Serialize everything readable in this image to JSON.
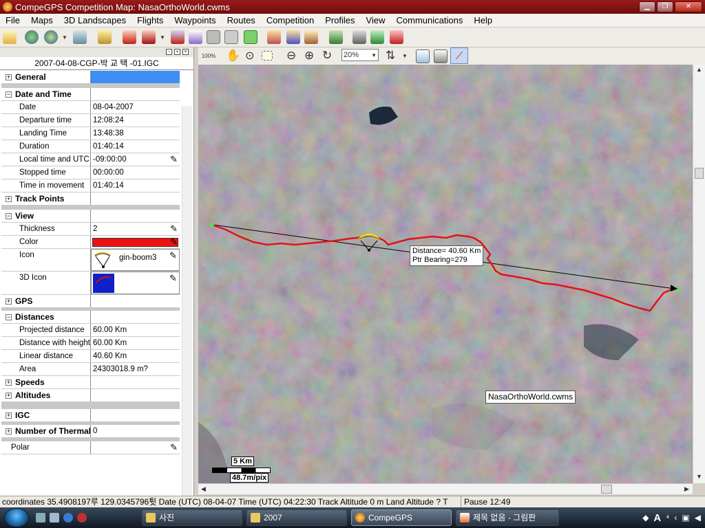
{
  "window": {
    "title": "CompeGPS Competition Map: NasaOrthoWorld.cwms"
  },
  "menu": [
    "File",
    "Maps",
    "3D Landscapes",
    "Flights",
    "Waypoints",
    "Routes",
    "Competition",
    "Profiles",
    "View",
    "Communications",
    "Help"
  ],
  "toolbar2": {
    "zoom_100": "100%",
    "zoom_value": "20%"
  },
  "leftpane": {
    "title": "2007-04-08-CGP-박 교 택 -01.IGC",
    "sections": {
      "general": "General",
      "datetime": "Date and Time",
      "trackpoints": "Track Points",
      "view": "View",
      "gps": "GPS",
      "distances": "Distances",
      "speeds": "Speeds",
      "altitudes": "Altitudes",
      "igc": "IGC",
      "thermals": "Number of Thermal",
      "thermals_val": "0",
      "polar": "Polar"
    },
    "datetime": [
      {
        "label": "Date",
        "value": "08-04-2007"
      },
      {
        "label": "Departure time",
        "value": "12:08:24"
      },
      {
        "label": "Landing Time",
        "value": "13:48:38"
      },
      {
        "label": "Duration",
        "value": "01:40:14"
      },
      {
        "label": "Local time and UTC d",
        "value": "-09:00:00"
      },
      {
        "label": "Stopped time",
        "value": "00:00:00"
      },
      {
        "label": "Time in movement",
        "value": "01:40:14"
      }
    ],
    "view": {
      "thickness_label": "Thickness",
      "thickness": "2",
      "color_label": "Color",
      "color": "#ee1111",
      "icon_label": "Icon",
      "icon_name": "gin-boom3",
      "icon3d_label": "3D Icon"
    },
    "distances": [
      {
        "label": "Projected distance",
        "value": "60.00 Km"
      },
      {
        "label": "Distance with height",
        "value": "60.00 Km"
      },
      {
        "label": "Linear distance",
        "value": "40.60 Km"
      },
      {
        "label": "Area",
        "value": "24303018.9 m?"
      }
    ]
  },
  "map": {
    "measure_distance": "Distance= 40.60 Km",
    "measure_bearing": "Ptr Bearing=279",
    "map_name": "NasaOrthoWorld.cwms",
    "scale_km": "5 Km",
    "scale_res": "48.7m/pix",
    "track_color": "#e01414"
  },
  "status": {
    "main": "coordinates 35.4908197루 129.0345796튓 Date (UTC) 08-04-07 Time (UTC) 04:22:30 Track Altitude 0 m Land Altitude ? T",
    "pause": "Pause 12:49"
  },
  "taskbar": {
    "tasks": [
      "사진",
      "2007",
      "CompeGPS",
      "제목 없음 - 그림판"
    ]
  }
}
